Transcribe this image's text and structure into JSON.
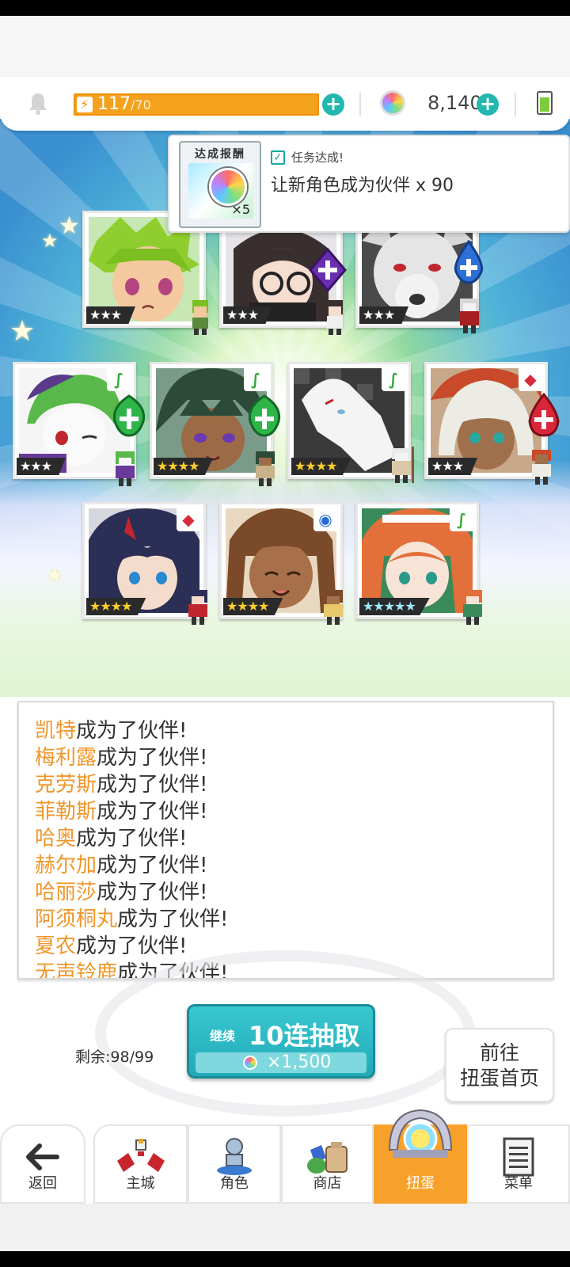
{
  "header": {
    "energy_current": "117",
    "energy_max": "/70",
    "energy_plus": "+",
    "gems": "8,140",
    "gems_plus": "+",
    "colors": {
      "energy": "#f4a11d",
      "plus": "#22b8b0"
    },
    "icons": [
      "bell-icon",
      "lightning-icon",
      "gem-icon",
      "battery-icon"
    ]
  },
  "reward_popup": {
    "box_title": "达成报酬",
    "box_qty": "×5",
    "check_mark": "✓",
    "mission_title": "任务达成!",
    "mission_desc": "让新角色成为伙伴 x 90"
  },
  "cards": [
    {
      "rarity": "★★★",
      "attr_icon": "",
      "accent": "#3a8a2a"
    },
    {
      "rarity": "★★★",
      "attr_icon": "",
      "accent": "#333333"
    },
    {
      "rarity": "★★★",
      "attr_icon": "",
      "accent": "#5a5a5a"
    },
    {
      "rarity": "★★★",
      "attr_icon": "leaf-icon",
      "accent": "#4aa84a"
    },
    {
      "rarity": "★★★★",
      "attr_icon": "leaf-icon",
      "accent": "#2d5a3a"
    },
    {
      "rarity": "★★★★",
      "attr_icon": "leaf-icon",
      "accent": "#d8d8d8"
    },
    {
      "rarity": "★★★",
      "attr_icon": "diamond-icon",
      "accent": "#e8d8c0"
    },
    {
      "rarity": "★★★★",
      "attr_icon": "diamond-icon",
      "accent": "#2b2f55"
    },
    {
      "rarity": "★★★★",
      "attr_icon": "circle-icon",
      "accent": "#7a4a2a"
    },
    {
      "rarity": "★★★★★",
      "attr_icon": "leaf-icon",
      "accent": "#e36f3a"
    }
  ],
  "log": {
    "suffix": "成为了伙伴!",
    "names": [
      "凯特",
      "梅利露",
      "克劳斯",
      "菲勒斯",
      "哈奥",
      "赫尔加",
      "哈丽莎",
      "阿须桐丸",
      "夏农",
      "无声铃鹿"
    ]
  },
  "actions": {
    "remaining": "剩余:98/99",
    "pull_sub": "继续",
    "pull_main": "10连抽取",
    "pull_cost": "×1,500",
    "gacha_home_line1": "前往",
    "gacha_home_line2": "扭蛋首页"
  },
  "nav": {
    "back": "返回",
    "main_city": "主城",
    "characters": "角色",
    "shop": "商店",
    "gacha": "扭蛋",
    "menu": "菜单",
    "active": "gacha"
  }
}
